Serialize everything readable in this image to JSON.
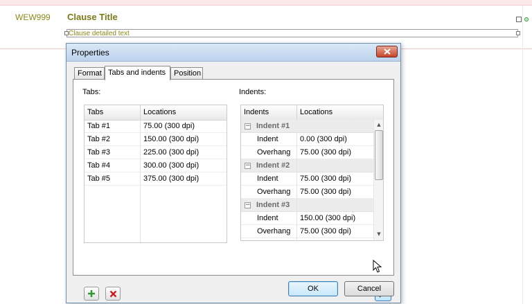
{
  "document": {
    "clause_id": "WEW999",
    "clause_title": "Clause Title",
    "clause_text": "Clause detailed text"
  },
  "dialog": {
    "title": "Properties",
    "tabs": [
      {
        "label": "Format"
      },
      {
        "label": "Tabs and indents"
      },
      {
        "label": "Position"
      }
    ],
    "active_tab": "Tabs and indents",
    "tabs_section": {
      "label": "Tabs:",
      "columns": [
        "Tabs",
        "Locations"
      ],
      "rows": [
        {
          "name": "Tab #1",
          "location": "75.00 (300 dpi)"
        },
        {
          "name": "Tab #2",
          "location": "150.00 (300 dpi)"
        },
        {
          "name": "Tab #3",
          "location": "225.00 (300 dpi)"
        },
        {
          "name": "Tab #4",
          "location": "300.00 (300 dpi)"
        },
        {
          "name": "Tab #5",
          "location": "375.00 (300 dpi)"
        }
      ]
    },
    "indents_section": {
      "label": "Indents:",
      "columns": [
        "Indents",
        "Locations"
      ],
      "groups": [
        {
          "label": "Indent #1",
          "toggle": "⊟",
          "indent_label": "Indent",
          "indent": "0.00 (300 dpi)",
          "overhang_label": "Overhang",
          "overhang": "75.00 (300 dpi)"
        },
        {
          "label": "Indent #2",
          "toggle": "⊟",
          "indent_label": "Indent",
          "indent": "75.00 (300 dpi)",
          "overhang_label": "Overhang",
          "overhang": "75.00 (300 dpi)"
        },
        {
          "label": "Indent #3",
          "toggle": "⊟",
          "indent_label": "Indent",
          "indent": "150.00 (300 dpi)",
          "overhang_label": "Overhang",
          "overhang": "75.00 (300 dpi)"
        }
      ]
    },
    "buttons": {
      "ok": "OK",
      "cancel": "Cancel"
    },
    "icons": {
      "add": "plus-icon",
      "remove": "delete-icon",
      "wand": "magic-wand-icon",
      "close": "close-icon"
    },
    "colors": {
      "add_green": "#2e9a2e",
      "remove_red": "#cc1a1a",
      "clause_text": "#8a8a1a"
    }
  }
}
